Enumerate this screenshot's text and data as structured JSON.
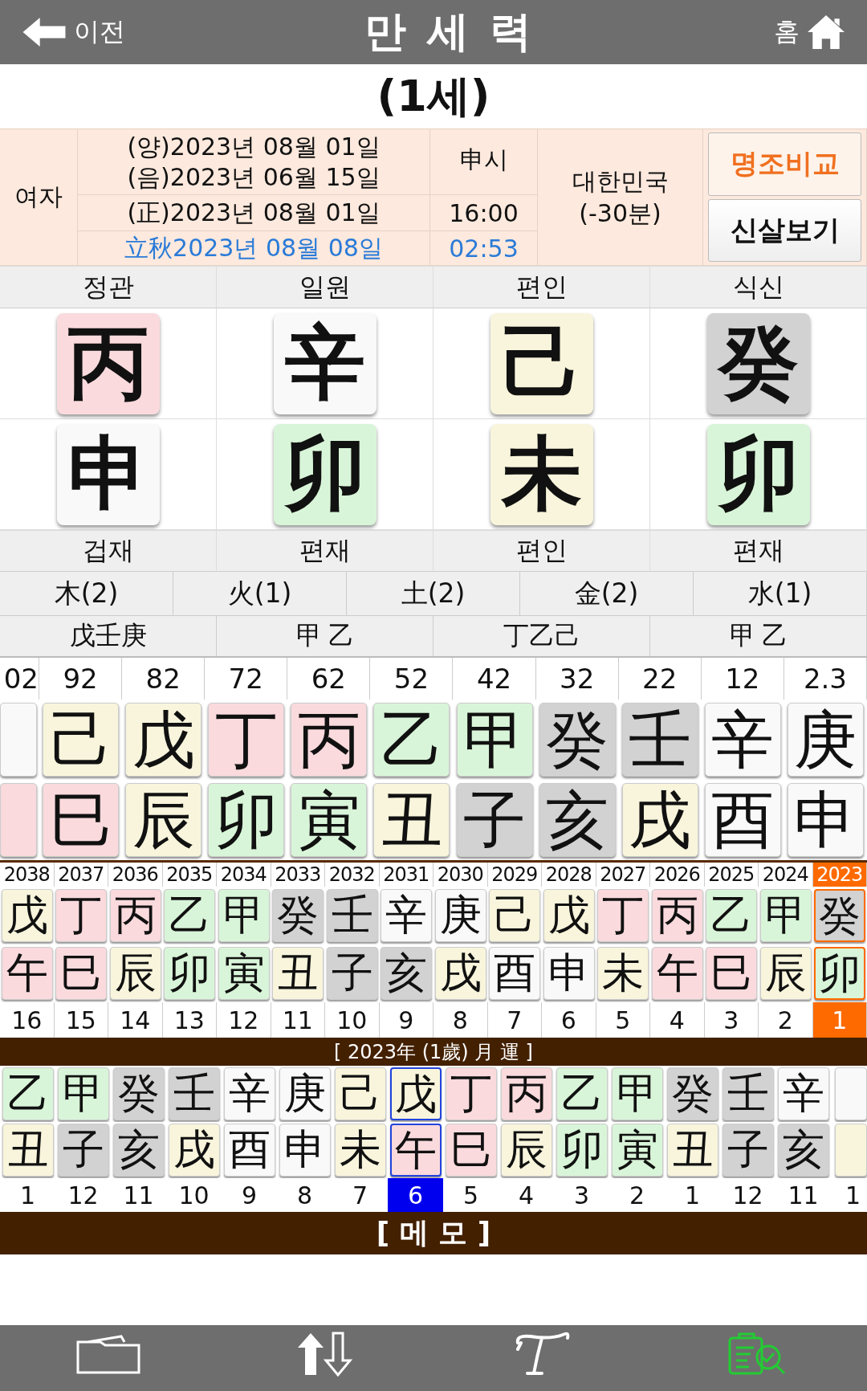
{
  "header": {
    "back": "이전",
    "title": "만 세 력",
    "home": "홈"
  },
  "age_title": "(1세)",
  "info": {
    "gender": "여자",
    "solar": "(양)2023년 08월 01일",
    "lunar": "(음)2023년 06월 15일",
    "hour": "申시",
    "corrected": "(正)2023년 08월 01일",
    "time": "16:00",
    "term": "立秋2023년 08월 08일",
    "term_time": "02:53",
    "country": "대한민국",
    "offset": "(-30분)",
    "buttons": [
      {
        "label": "명조비교",
        "color": "#f07020"
      },
      {
        "label": "신살보기",
        "color": "#111111"
      }
    ]
  },
  "pillars": [
    {
      "top_label": "정관",
      "stem": {
        "char": "丙",
        "color": "#fadadd"
      },
      "branch": {
        "char": "申",
        "color": "#f9f9f9"
      },
      "bottom_label": "겁재",
      "hidden": "戊壬庚"
    },
    {
      "top_label": "일원",
      "stem": {
        "char": "辛",
        "color": "#f9f9f9"
      },
      "branch": {
        "char": "卯",
        "color": "#d9f5d9"
      },
      "bottom_label": "편재",
      "hidden": "甲 乙"
    },
    {
      "top_label": "편인",
      "stem": {
        "char": "己",
        "color": "#f8f5dc"
      },
      "branch": {
        "char": "未",
        "color": "#f8f5dc"
      },
      "bottom_label": "편인",
      "hidden": "丁乙己"
    },
    {
      "top_label": "식신",
      "stem": {
        "char": "癸",
        "color": "#d2d2d2"
      },
      "branch": {
        "char": "卯",
        "color": "#d9f5d9"
      },
      "bottom_label": "편재",
      "hidden": "甲 乙"
    }
  ],
  "elements": [
    "木(2)",
    "火(1)",
    "土(2)",
    "金(2)",
    "水(1)"
  ],
  "daewoon": {
    "cut_column": {
      "age": "02",
      "stem": {
        "color": "#f9f9f9"
      },
      "branch": {
        "color": "#fadadd"
      }
    },
    "columns": [
      {
        "age": "92",
        "stem": {
          "char": "己",
          "color": "#f8f5dc"
        },
        "branch": {
          "char": "巳",
          "color": "#fadadd"
        }
      },
      {
        "age": "82",
        "stem": {
          "char": "戊",
          "color": "#f8f5dc"
        },
        "branch": {
          "char": "辰",
          "color": "#f8f5dc"
        }
      },
      {
        "age": "72",
        "stem": {
          "char": "丁",
          "color": "#fadadd"
        },
        "branch": {
          "char": "卯",
          "color": "#d9f5d9"
        }
      },
      {
        "age": "62",
        "stem": {
          "char": "丙",
          "color": "#fadadd"
        },
        "branch": {
          "char": "寅",
          "color": "#d9f5d9"
        }
      },
      {
        "age": "52",
        "stem": {
          "char": "乙",
          "color": "#d9f5d9"
        },
        "branch": {
          "char": "丑",
          "color": "#f8f5dc"
        }
      },
      {
        "age": "42",
        "stem": {
          "char": "甲",
          "color": "#d9f5d9"
        },
        "branch": {
          "char": "子",
          "color": "#d2d2d2"
        }
      },
      {
        "age": "32",
        "stem": {
          "char": "癸",
          "color": "#d2d2d2"
        },
        "branch": {
          "char": "亥",
          "color": "#d2d2d2"
        }
      },
      {
        "age": "22",
        "stem": {
          "char": "壬",
          "color": "#d2d2d2"
        },
        "branch": {
          "char": "戌",
          "color": "#f8f5dc"
        }
      },
      {
        "age": "12",
        "stem": {
          "char": "辛",
          "color": "#f9f9f9"
        },
        "branch": {
          "char": "酉",
          "color": "#f9f9f9"
        }
      },
      {
        "age": "2.3",
        "stem": {
          "char": "庚",
          "color": "#f9f9f9"
        },
        "branch": {
          "char": "申",
          "color": "#f9f9f9"
        }
      }
    ]
  },
  "years": [
    {
      "year": "2038",
      "stem": {
        "char": "戊",
        "color": "#f8f5dc"
      },
      "branch": {
        "char": "午",
        "color": "#fadadd"
      },
      "age": "16",
      "selected": false
    },
    {
      "year": "2037",
      "stem": {
        "char": "丁",
        "color": "#fadadd"
      },
      "branch": {
        "char": "巳",
        "color": "#fadadd"
      },
      "age": "15",
      "selected": false
    },
    {
      "year": "2036",
      "stem": {
        "char": "丙",
        "color": "#fadadd"
      },
      "branch": {
        "char": "辰",
        "color": "#f8f5dc"
      },
      "age": "14",
      "selected": false
    },
    {
      "year": "2035",
      "stem": {
        "char": "乙",
        "color": "#d9f5d9"
      },
      "branch": {
        "char": "卯",
        "color": "#d9f5d9"
      },
      "age": "13",
      "selected": false
    },
    {
      "year": "2034",
      "stem": {
        "char": "甲",
        "color": "#d9f5d9"
      },
      "branch": {
        "char": "寅",
        "color": "#d9f5d9"
      },
      "age": "12",
      "selected": false
    },
    {
      "year": "2033",
      "stem": {
        "char": "癸",
        "color": "#d2d2d2"
      },
      "branch": {
        "char": "丑",
        "color": "#f8f5dc"
      },
      "age": "11",
      "selected": false
    },
    {
      "year": "2032",
      "stem": {
        "char": "壬",
        "color": "#d2d2d2"
      },
      "branch": {
        "char": "子",
        "color": "#d2d2d2"
      },
      "age": "10",
      "selected": false
    },
    {
      "year": "2031",
      "stem": {
        "char": "辛",
        "color": "#f9f9f9"
      },
      "branch": {
        "char": "亥",
        "color": "#d2d2d2"
      },
      "age": "9",
      "selected": false
    },
    {
      "year": "2030",
      "stem": {
        "char": "庚",
        "color": "#f9f9f9"
      },
      "branch": {
        "char": "戌",
        "color": "#f8f5dc"
      },
      "age": "8",
      "selected": false
    },
    {
      "year": "2029",
      "stem": {
        "char": "己",
        "color": "#f8f5dc"
      },
      "branch": {
        "char": "酉",
        "color": "#f9f9f9"
      },
      "age": "7",
      "selected": false
    },
    {
      "year": "2028",
      "stem": {
        "char": "戊",
        "color": "#f8f5dc"
      },
      "branch": {
        "char": "申",
        "color": "#f9f9f9"
      },
      "age": "6",
      "selected": false
    },
    {
      "year": "2027",
      "stem": {
        "char": "丁",
        "color": "#fadadd"
      },
      "branch": {
        "char": "未",
        "color": "#f8f5dc"
      },
      "age": "5",
      "selected": false
    },
    {
      "year": "2026",
      "stem": {
        "char": "丙",
        "color": "#fadadd"
      },
      "branch": {
        "char": "午",
        "color": "#fadadd"
      },
      "age": "4",
      "selected": false
    },
    {
      "year": "2025",
      "stem": {
        "char": "乙",
        "color": "#d9f5d9"
      },
      "branch": {
        "char": "巳",
        "color": "#fadadd"
      },
      "age": "3",
      "selected": false
    },
    {
      "year": "2024",
      "stem": {
        "char": "甲",
        "color": "#d9f5d9"
      },
      "branch": {
        "char": "辰",
        "color": "#f8f5dc"
      },
      "age": "2",
      "selected": false
    },
    {
      "year": "2023",
      "stem": {
        "char": "癸",
        "color": "#d2d2d2"
      },
      "branch": {
        "char": "卯",
        "color": "#d9f5d9"
      },
      "age": "1",
      "selected": true
    }
  ],
  "month_title": "[ 2023年 (1歲) 月 運 ]",
  "months": {
    "columns": [
      {
        "stem": {
          "char": "乙",
          "color": "#d9f5d9"
        },
        "branch": {
          "char": "丑",
          "color": "#f8f5dc"
        },
        "month": "1",
        "selected": false
      },
      {
        "stem": {
          "char": "甲",
          "color": "#d9f5d9"
        },
        "branch": {
          "char": "子",
          "color": "#d2d2d2"
        },
        "month": "12",
        "selected": false
      },
      {
        "stem": {
          "char": "癸",
          "color": "#d2d2d2"
        },
        "branch": {
          "char": "亥",
          "color": "#d2d2d2"
        },
        "month": "11",
        "selected": false
      },
      {
        "stem": {
          "char": "壬",
          "color": "#d2d2d2"
        },
        "branch": {
          "char": "戌",
          "color": "#f8f5dc"
        },
        "month": "10",
        "selected": false
      },
      {
        "stem": {
          "char": "辛",
          "color": "#f9f9f9"
        },
        "branch": {
          "char": "酉",
          "color": "#f9f9f9"
        },
        "month": "9",
        "selected": false
      },
      {
        "stem": {
          "char": "庚",
          "color": "#f9f9f9"
        },
        "branch": {
          "char": "申",
          "color": "#f9f9f9"
        },
        "month": "8",
        "selected": false
      },
      {
        "stem": {
          "char": "己",
          "color": "#f8f5dc"
        },
        "branch": {
          "char": "未",
          "color": "#f8f5dc"
        },
        "month": "7",
        "selected": false
      },
      {
        "stem": {
          "char": "戊",
          "color": "#f8f5dc"
        },
        "branch": {
          "char": "午",
          "color": "#fadadd"
        },
        "month": "6",
        "selected": true
      },
      {
        "stem": {
          "char": "丁",
          "color": "#fadadd"
        },
        "branch": {
          "char": "巳",
          "color": "#fadadd"
        },
        "month": "5",
        "selected": false
      },
      {
        "stem": {
          "char": "丙",
          "color": "#fadadd"
        },
        "branch": {
          "char": "辰",
          "color": "#f8f5dc"
        },
        "month": "4",
        "selected": false
      },
      {
        "stem": {
          "char": "乙",
          "color": "#d9f5d9"
        },
        "branch": {
          "char": "卯",
          "color": "#d9f5d9"
        },
        "month": "3",
        "selected": false
      },
      {
        "stem": {
          "char": "甲",
          "color": "#d9f5d9"
        },
        "branch": {
          "char": "寅",
          "color": "#d9f5d9"
        },
        "month": "2",
        "selected": false
      },
      {
        "stem": {
          "char": "癸",
          "color": "#d2d2d2"
        },
        "branch": {
          "char": "丑",
          "color": "#f8f5dc"
        },
        "month": "1",
        "selected": false
      },
      {
        "stem": {
          "char": "壬",
          "color": "#d2d2d2"
        },
        "branch": {
          "char": "子",
          "color": "#d2d2d2"
        },
        "month": "12",
        "selected": false
      },
      {
        "stem": {
          "char": "辛",
          "color": "#f9f9f9"
        },
        "branch": {
          "char": "亥",
          "color": "#d2d2d2"
        },
        "month": "11",
        "selected": false
      }
    ],
    "cut_column": {
      "stem": {
        "color": "#f9f9f9"
      },
      "branch": {
        "color": "#f8f5dc"
      },
      "month": "1"
    }
  },
  "memo_title": "[ 메   모 ]"
}
